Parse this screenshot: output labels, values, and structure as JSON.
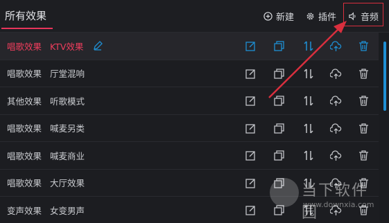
{
  "header": {
    "title": "所有效果",
    "buttons": [
      {
        "label": "新建",
        "icon": "plus-circle-icon"
      },
      {
        "label": "插件",
        "icon": "gear-icon"
      },
      {
        "label": "音频",
        "icon": "speaker-icon"
      }
    ]
  },
  "rows": [
    {
      "category": "唱歌效果",
      "name": "KTV效果",
      "active": true
    },
    {
      "category": "唱歌效果",
      "name": "厅堂混响"
    },
    {
      "category": "其他效果",
      "name": "听歌模式"
    },
    {
      "category": "唱歌效果",
      "name": "喊麦另类"
    },
    {
      "category": "唱歌效果",
      "name": "喊麦商业"
    },
    {
      "category": "唱歌效果",
      "name": "大厅效果"
    },
    {
      "category": "变声效果",
      "name": "女变男声"
    }
  ],
  "row_actions": [
    "edit-icon",
    "copy-icon",
    "sort-icon",
    "upload-icon",
    "trash-icon"
  ],
  "watermark": {
    "text": "当下软件园",
    "url": "www.downxia.com"
  },
  "colors": {
    "accent": "#e8355a",
    "active_action": "#1e8fd4",
    "annotation": "#d92f3e"
  }
}
